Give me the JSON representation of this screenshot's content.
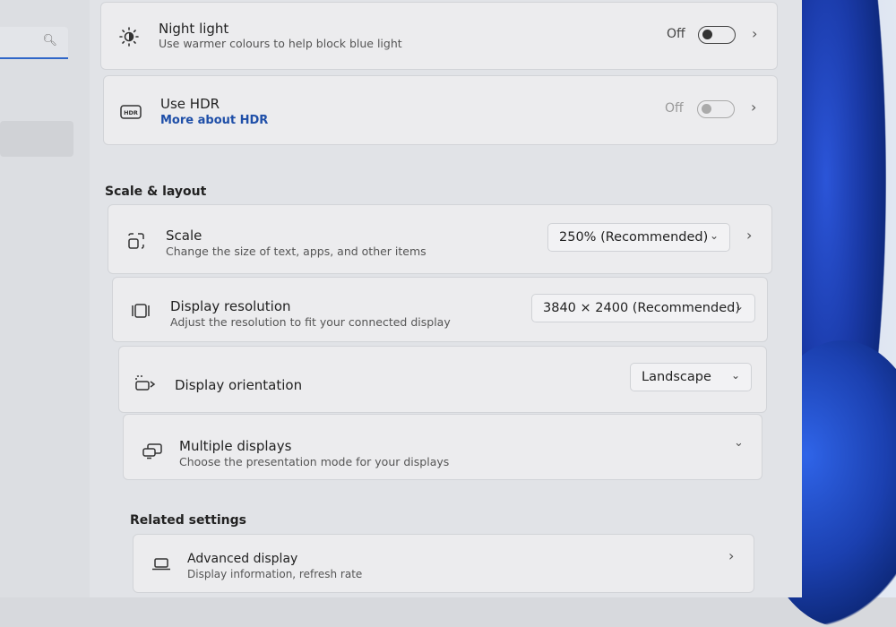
{
  "nav": {
    "search_icon": "search-icon"
  },
  "night_light": {
    "title": "Night light",
    "subtitle": "Use warmer colours to help block blue light",
    "state": "Off",
    "icon": "brightness-icon"
  },
  "hdr": {
    "title": "Use HDR",
    "link": "More about HDR",
    "state": "Off",
    "icon": "hdr-icon"
  },
  "scale_layout": {
    "heading": "Scale & layout",
    "scale": {
      "title": "Scale",
      "subtitle": "Change the size of text, apps, and other items",
      "value": "250% (Recommended)",
      "icon": "scale-icon"
    },
    "resolution": {
      "title": "Display resolution",
      "subtitle": "Adjust the resolution to fit your connected display",
      "value": "3840 × 2400 (Recommended)",
      "icon": "resolution-icon"
    },
    "orientation": {
      "title": "Display orientation",
      "value": "Landscape",
      "icon": "orientation-icon"
    },
    "multiple": {
      "title": "Multiple displays",
      "subtitle": "Choose the presentation mode for your displays",
      "icon": "multiple-displays-icon"
    }
  },
  "related": {
    "heading": "Related settings",
    "advanced": {
      "title": "Advanced display",
      "subtitle": "Display information, refresh rate",
      "icon": "laptop-icon"
    }
  }
}
